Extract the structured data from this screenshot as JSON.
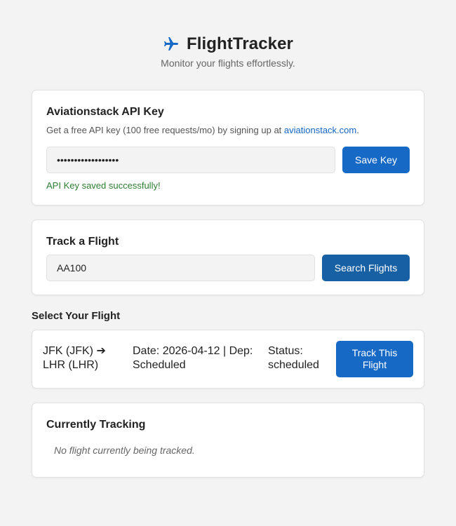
{
  "header": {
    "icon": "airplane-icon",
    "title": "FlightTracker",
    "subtitle": "Monitor your flights effortlessly."
  },
  "api_key": {
    "title": "Aviationstack API Key",
    "help_prefix": "Get a free API key (100 free requests/mo) by signing up at ",
    "help_link": "aviationstack.com",
    "help_suffix": ".",
    "input_value": "••••••••••••••••••",
    "save_label": "Save Key",
    "success_message": "API Key saved successfully!"
  },
  "track": {
    "title": "Track a Flight",
    "input_value": "AA100",
    "search_label": "Search Flights"
  },
  "select": {
    "title": "Select Your Flight",
    "flights": [
      {
        "route": "JFK (JFK) ➔ LHR (LHR)",
        "date_dep": "Date: 2026-04-12 | Dep: Scheduled",
        "status": "Status: scheduled",
        "track_label": "Track This Flight"
      }
    ]
  },
  "current": {
    "title": "Currently Tracking",
    "empty_message": "No flight currently being tracked."
  },
  "colors": {
    "accent": "#1769c6",
    "success": "#2e7d32",
    "background": "#f3f3f3"
  }
}
